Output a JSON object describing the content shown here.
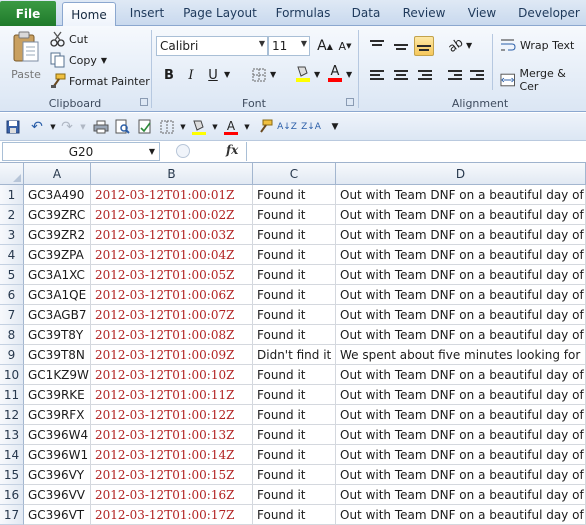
{
  "tabs": {
    "file": "File",
    "items": [
      "Home",
      "Insert",
      "Page Layout",
      "Formulas",
      "Data",
      "Review",
      "View",
      "Developer"
    ],
    "active": "Home"
  },
  "clipboard": {
    "paste": "Paste",
    "cut": "Cut",
    "copy": "Copy",
    "format_painter": "Format Painter",
    "group_label": "Clipboard"
  },
  "font": {
    "name": "Calibri",
    "size": "11",
    "bold": "B",
    "italic": "I",
    "underline": "U",
    "grow": "A",
    "shrink": "A",
    "color_letter": "A",
    "group_label": "Font",
    "fill_color": "#ffff00",
    "font_color": "#ff0000"
  },
  "alignment": {
    "wrap_text": "Wrap Text",
    "merge_center": "Merge & Cer",
    "group_label": "Alignment"
  },
  "formula_bar": {
    "name_box": "G20",
    "fx": "fx",
    "value": ""
  },
  "columns": [
    "A",
    "B",
    "C",
    "D"
  ],
  "rows": [
    {
      "n": "1",
      "a": "GC3A490",
      "b": "2012-03-12T01:00:01Z",
      "c": "Found it",
      "d": "Out with Team DNF on a beautiful day of"
    },
    {
      "n": "2",
      "a": "GC39ZRC",
      "b": "2012-03-12T01:00:02Z",
      "c": "Found it",
      "d": "Out with Team DNF on a beautiful day of"
    },
    {
      "n": "3",
      "a": "GC39ZR2",
      "b": "2012-03-12T01:00:03Z",
      "c": "Found it",
      "d": "Out with Team DNF on a beautiful day of"
    },
    {
      "n": "4",
      "a": "GC39ZPA",
      "b": "2012-03-12T01:00:04Z",
      "c": "Found it",
      "d": "Out with Team DNF on a beautiful day of"
    },
    {
      "n": "5",
      "a": "GC3A1XC",
      "b": "2012-03-12T01:00:05Z",
      "c": "Found it",
      "d": "Out with Team DNF on a beautiful day of"
    },
    {
      "n": "6",
      "a": "GC3A1QE",
      "b": "2012-03-12T01:00:06Z",
      "c": "Found it",
      "d": "Out with Team DNF on a beautiful day of"
    },
    {
      "n": "7",
      "a": "GC3AGB7",
      "b": "2012-03-12T01:00:07Z",
      "c": "Found it",
      "d": "Out with Team DNF on a beautiful day of"
    },
    {
      "n": "8",
      "a": "GC39T8Y",
      "b": "2012-03-12T01:00:08Z",
      "c": "Found it",
      "d": "Out with Team DNF on a beautiful day of"
    },
    {
      "n": "9",
      "a": "GC39T8N",
      "b": "2012-03-12T01:00:09Z",
      "c": "Didn't find it",
      "d": "We spent about five minutes looking for"
    },
    {
      "n": "10",
      "a": "GC1KZ9W",
      "b": "2012-03-12T01:00:10Z",
      "c": "Found it",
      "d": "Out with Team DNF on a beautiful day of"
    },
    {
      "n": "11",
      "a": "GC39RKE",
      "b": "2012-03-12T01:00:11Z",
      "c": "Found it",
      "d": "Out with Team DNF on a beautiful day of"
    },
    {
      "n": "12",
      "a": "GC39RFX",
      "b": "2012-03-12T01:00:12Z",
      "c": "Found it",
      "d": "Out with Team DNF on a beautiful day of"
    },
    {
      "n": "13",
      "a": "GC396W4",
      "b": "2012-03-12T01:00:13Z",
      "c": "Found it",
      "d": "Out with Team DNF on a beautiful day of"
    },
    {
      "n": "14",
      "a": "GC396W1",
      "b": "2012-03-12T01:00:14Z",
      "c": "Found it",
      "d": "Out with Team DNF on a beautiful day of"
    },
    {
      "n": "15",
      "a": "GC396VY",
      "b": "2012-03-12T01:00:15Z",
      "c": "Found it",
      "d": "Out with Team DNF on a beautiful day of"
    },
    {
      "n": "16",
      "a": "GC396VV",
      "b": "2012-03-12T01:00:16Z",
      "c": "Found it",
      "d": "Out with Team DNF on a beautiful day of"
    },
    {
      "n": "17",
      "a": "GC396VT",
      "b": "2012-03-12T01:00:17Z",
      "c": "Found it",
      "d": "Out with Team DNF on a beautiful day of"
    }
  ]
}
